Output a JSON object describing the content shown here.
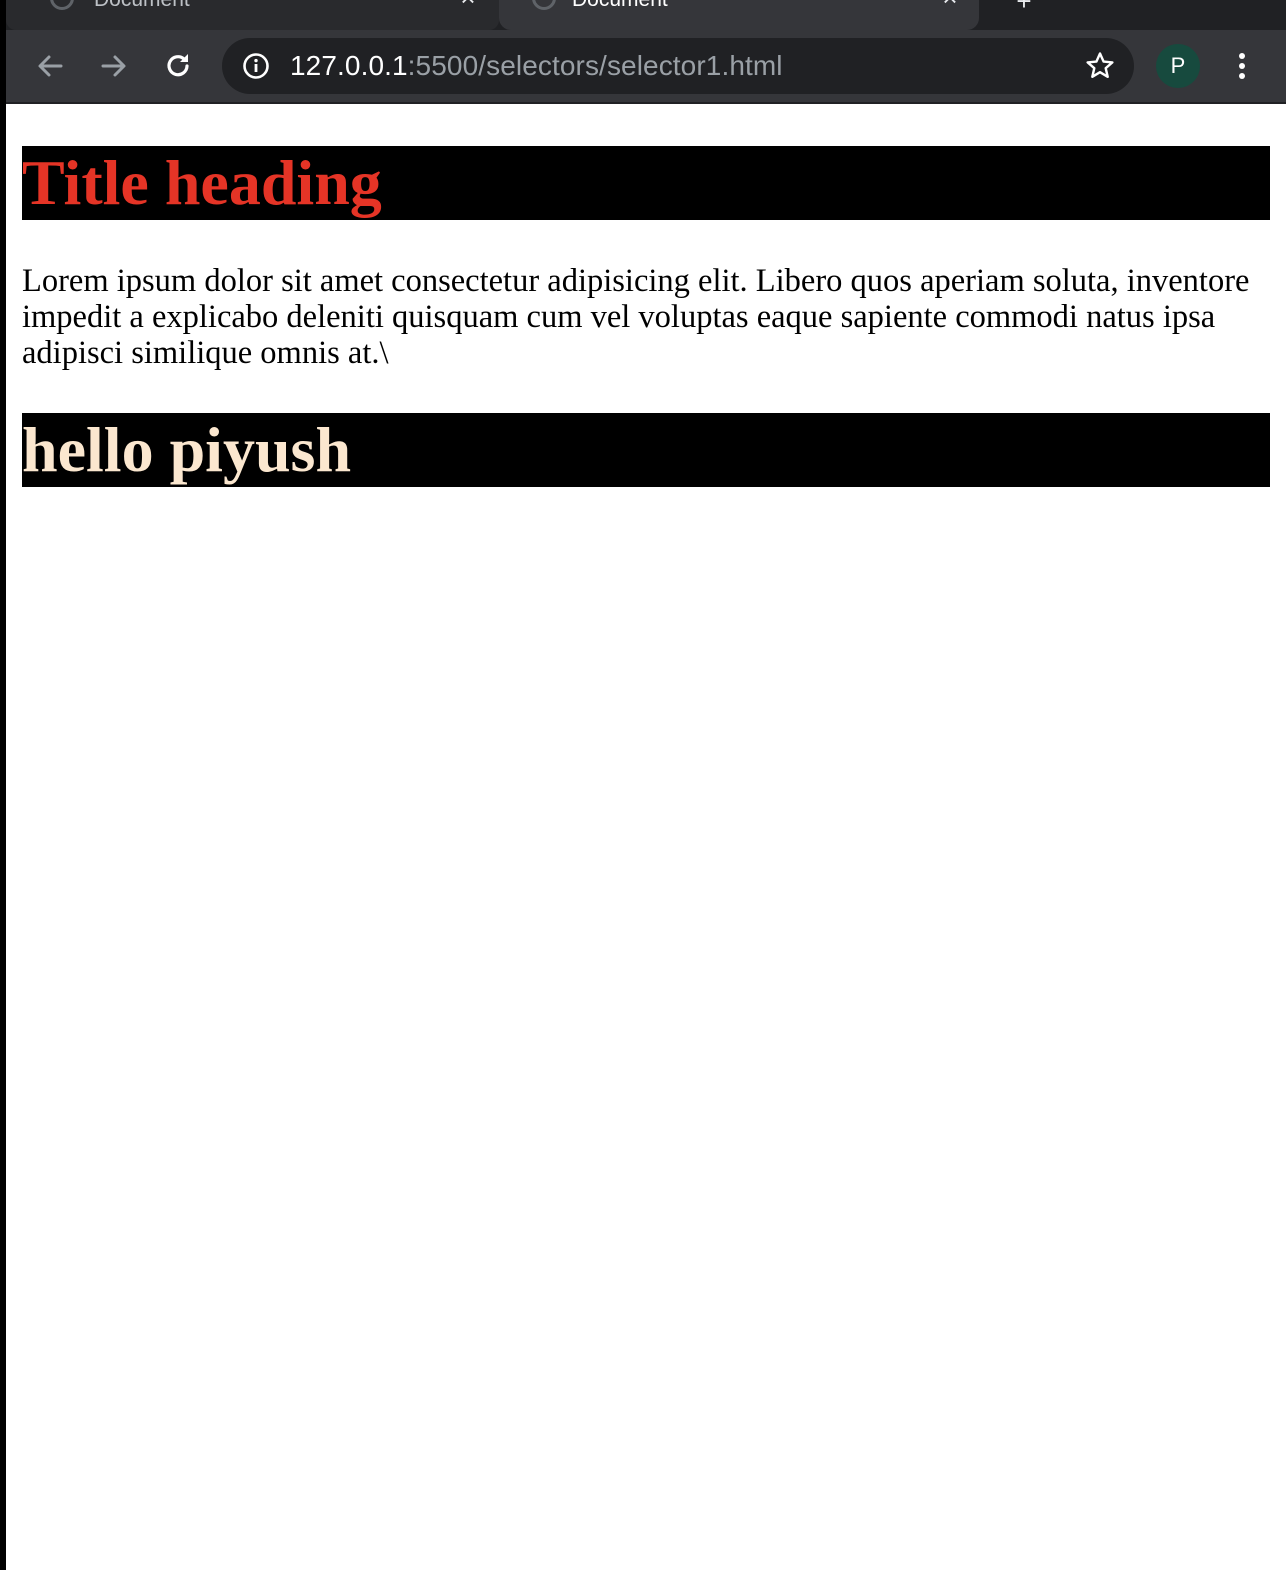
{
  "browser": {
    "tabs": [
      {
        "title": "Document",
        "active": false
      },
      {
        "title": "Document",
        "active": true
      }
    ],
    "new_tab_icon": "plus-icon",
    "address": {
      "host": "127.0.0.1",
      "rest": ":5500/selectors/selector1.html"
    },
    "profile_initial": "P",
    "colors": {
      "tabstrip": "#202124",
      "toolbar": "#35363a",
      "omnibox": "#202124",
      "avatar": "#174a3e"
    }
  },
  "page": {
    "title_heading": "Title heading",
    "paragraph": "Lorem ipsum dolor sit amet consectetur adipisicing elit. Libero quos aperiam soluta, inventore impedit a explicabo deleniti quisquam cum vel voluptas eaque sapiente commodi natus ipsa adipisci similique omnis at.\\",
    "second_heading": "hello piyush",
    "colors": {
      "heading_background": "#000000",
      "title_heading_text": "#e53426",
      "second_heading_text": "#fbe7cf"
    }
  }
}
